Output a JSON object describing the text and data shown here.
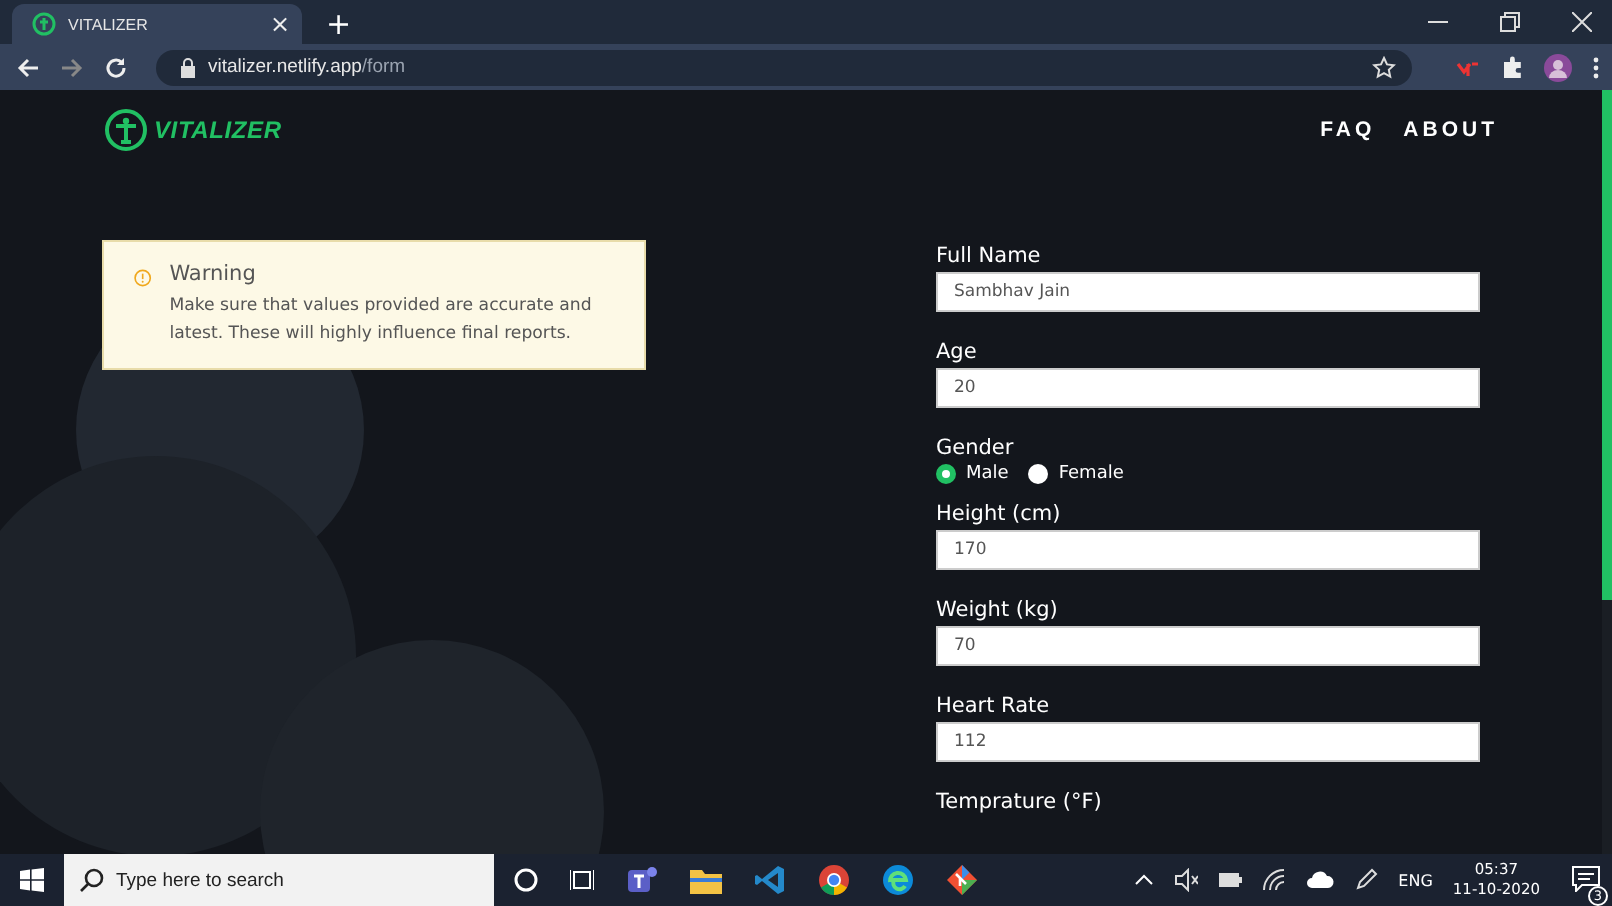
{
  "browser": {
    "tab": {
      "title": "VITALIZER",
      "close": "×",
      "selected": true
    },
    "new_tab": "+",
    "address": {
      "host": "vitalizer.netlify.app",
      "path": "/form"
    }
  },
  "header": {
    "logo": "VITALIZER",
    "nav": [
      "FAQ",
      "ABOUT"
    ]
  },
  "warning": {
    "title": "Warning",
    "message": "Make sure that values provided are accurate and latest. These will highly influence final reports."
  },
  "form": {
    "fields": [
      {
        "kind": "text",
        "label": "Full Name",
        "value": "Sambhav Jain"
      },
      {
        "kind": "text",
        "label": "Age",
        "value": "20"
      },
      {
        "kind": "radio",
        "label": "Gender",
        "options": [
          {
            "label": "Male",
            "selected": true
          },
          {
            "label": "Female",
            "selected": false
          }
        ]
      },
      {
        "kind": "text",
        "label": "Height (cm)",
        "value": "170"
      },
      {
        "kind": "text",
        "label": "Weight (kg)",
        "value": "70"
      },
      {
        "kind": "text",
        "label": "Heart Rate",
        "value": "112"
      },
      {
        "kind": "label",
        "label": "Temprature (°F)"
      }
    ]
  },
  "taskbar": {
    "search_placeholder": "Type here to search",
    "language": "ENG",
    "time": "05:37",
    "date": "11-10-2020",
    "notifications": "3"
  }
}
